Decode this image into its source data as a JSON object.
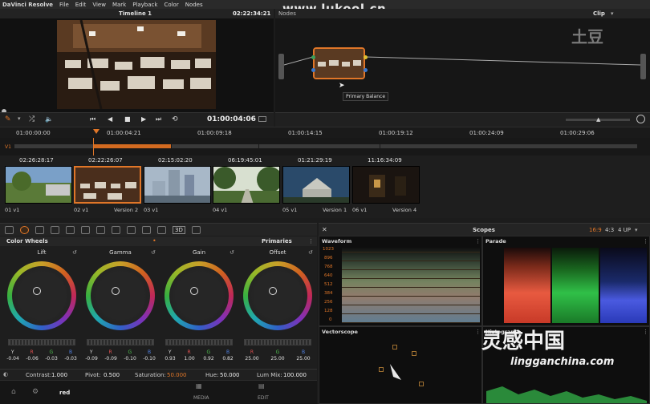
{
  "menu": [
    "DaVinci Resolve",
    "File",
    "Edit",
    "View",
    "Mark",
    "Playback",
    "Color",
    "Nodes"
  ],
  "watermark_top": "www.lukool.cn",
  "viewer": {
    "timeline_title": "Timeline 1",
    "timecode": "02:22:34:21",
    "nodes_label": "Nodes",
    "clip_label": "Clip",
    "frame_count": "01:00:04:06"
  },
  "node_tooltip": "Primary Balance",
  "ruler": [
    "01:00:00:00",
    "01:00:04:21",
    "01:00:09:18",
    "01:00:14:15",
    "01:00:19:12",
    "01:00:24:09",
    "01:00:29:06"
  ],
  "track_label": "V1",
  "clips": [
    {
      "tc": "02:26:28:17",
      "label": "01  v1",
      "version": ""
    },
    {
      "tc": "02:22:26:07",
      "label": "02  v1",
      "version": "Version 2"
    },
    {
      "tc": "02:15:02:20",
      "label": "03  v1",
      "version": ""
    },
    {
      "tc": "06:19:45:01",
      "label": "04  v1",
      "version": ""
    },
    {
      "tc": "01:21:29:19",
      "label": "05  v1",
      "version": "Version 1"
    },
    {
      "tc": "11:16:34:09",
      "label": "06  v1",
      "version": "Version 4"
    }
  ],
  "panel": {
    "title": "Color Wheels",
    "mode": "Primaries",
    "toggle_3d": "3D"
  },
  "wheels": [
    {
      "name": "Lift",
      "vals": [
        "-0.04",
        "-0.06",
        "-0.03",
        "-0.03"
      ]
    },
    {
      "name": "Gamma",
      "vals": [
        "-0.09",
        "-0.09",
        "-0.10",
        "-0.10"
      ]
    },
    {
      "name": "Gain",
      "vals": [
        "0.93",
        "1.00",
        "0.92",
        "0.82"
      ]
    },
    {
      "name": "Offset",
      "vals": [
        "25.00",
        "25.00",
        "25.00",
        "25.00"
      ]
    }
  ],
  "ygb": [
    "Y",
    "R",
    "G",
    "B"
  ],
  "params": {
    "contrast_label": "Contrast:",
    "contrast": "1.000",
    "pivot_label": "Pivot:",
    "pivot": "0.500",
    "saturation_label": "Saturation:",
    "saturation": "50.000",
    "hue_label": "Hue:",
    "hue": "50.000",
    "lummix_label": "Lum Mix:",
    "lummix": "100.000"
  },
  "footer": {
    "name": "red",
    "media": "MEDIA",
    "edit": "EDIT"
  },
  "scopes": {
    "title": "Scopes",
    "ratio_a": "16:9",
    "ratio_b": "4:3",
    "layout": "4 UP",
    "waveform": "Waveform",
    "parade": "Parade",
    "vectorscope": "Vectorscope",
    "histogram": "Histogram",
    "levels": [
      "1023",
      "896",
      "768",
      "640",
      "512",
      "384",
      "256",
      "128",
      "0"
    ]
  },
  "watermark_cn": "灵感中国",
  "watermark_url": "lingganchina.com",
  "watermark_td": "土豆",
  "colors": {
    "accent": "#e07628"
  }
}
